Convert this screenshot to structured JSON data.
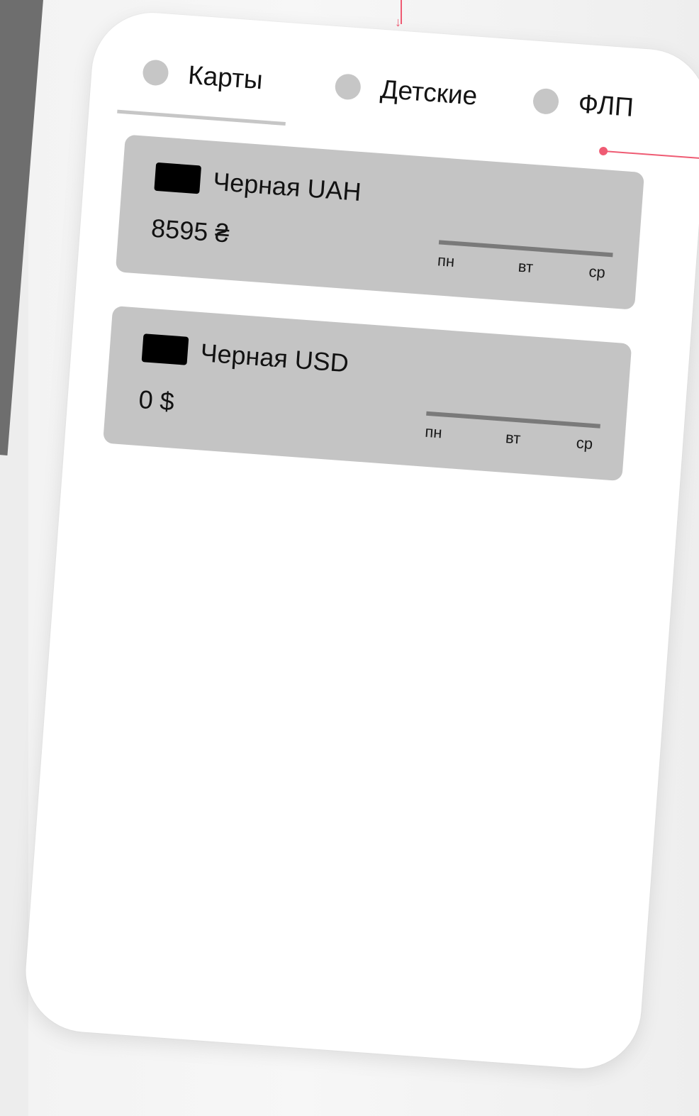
{
  "tabs": [
    {
      "label": "Карты",
      "active": true
    },
    {
      "label": "Детские",
      "active": false
    },
    {
      "label": "ФЛП",
      "active": false
    }
  ],
  "cards": [
    {
      "title": "Черная UAH",
      "balance": "8595 ₴",
      "chart_ticks": [
        "пн",
        "вт",
        "ср"
      ]
    },
    {
      "title": "Черная USD",
      "balance": "0 $",
      "chart_ticks": [
        "пн",
        "вт",
        "ср"
      ]
    }
  ],
  "colors": {
    "accent_connector": "#ef5b73",
    "tab_dot": "#c6c6c6",
    "card_bg": "#c4c4c4",
    "chart_axis": "#7a7a7a"
  },
  "icons": {
    "card_icon": "card-chip-icon"
  }
}
